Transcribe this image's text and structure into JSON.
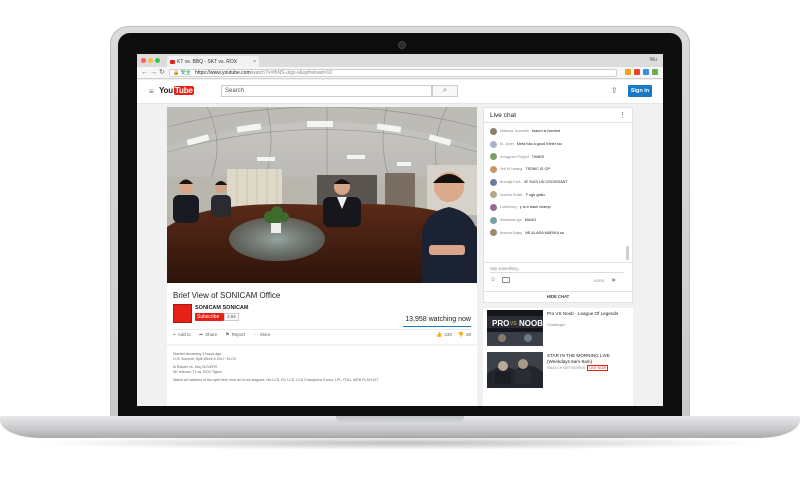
{
  "browser": {
    "tab_title": "KT vs. BBQ - SKT vs. ROX",
    "tab_close": "×",
    "user": "Wu",
    "back_glyph": "←",
    "forward_glyph": "→",
    "reload_glyph": "↻",
    "lock_glyph": "🔒",
    "secure_label": "安全",
    "url_host": "https://www.youtube.com",
    "url_rest": "/watch?v=fhNS-uIgx-s&spfreload=10",
    "menu_glyph": "⋮"
  },
  "header": {
    "menu_glyph": "≡",
    "logo_you": "You",
    "logo_tube": "Tube",
    "search_placeholder": "Search",
    "search_glyph": "⌕",
    "upload_glyph": "⇪",
    "signin_label": "Sign in"
  },
  "video": {
    "title": "Brief View of SONICAM Office",
    "channel": "SONICAM SONICAM",
    "subscribe_label": "Subscribe",
    "subscriber_count": "2,94",
    "watching": "13,958 watching now",
    "actions": [
      {
        "icon": "+",
        "label": "Add to"
      },
      {
        "icon": "➦",
        "label": "Share"
      },
      {
        "icon": "⚑",
        "label": "Report"
      },
      {
        "icon": "⋯",
        "label": "More"
      }
    ],
    "likes": "439",
    "dislikes": "28"
  },
  "description": {
    "lines": [
      "Started streaming 3 hours ago",
      "LCK Summer Split Week 8 2017: KLCK",
      "",
      "kt Rolster vs. bbq OLIVERS",
      "SK telecom T1 vs. ROX Tigers",
      "",
      "Watch all matches of the split here from all of our leagues: NA LCS, EU LCS, LCK Champions Korea, LPL, FULL WEB PLAYLIST"
    ]
  },
  "chat": {
    "title": "Live chat",
    "menu_glyph": "⋮",
    "messages": [
      {
        "author": "Mateusz Grzesiek",
        "text": "braum is banned",
        "color": "#8e7f6a"
      },
      {
        "author": "M. Janet",
        "text": "Meta has a good Kfeier too",
        "color": "#a8b4c4"
      },
      {
        "author": "Zsingyuen Project",
        "text": "TIIMKS",
        "color": "#7b9e6b"
      },
      {
        "author": "Jeff W Hwang",
        "text": "TSDMC IS OP",
        "color": "#c59a6a"
      },
      {
        "author": "Brendja Fers",
        "text": "JE SUIS UN CROISSANT",
        "color": "#6a7fa0"
      },
      {
        "author": "Andrew Butler",
        "text": "F ugh gatiu",
        "color": "#b5a58a"
      },
      {
        "author": "LobMoney",
        "text": "y is a trash champ",
        "color": "#9a6a8e"
      },
      {
        "author": "dimartedo gia",
        "text": "MAHO",
        "color": "#7aa0a8"
      },
      {
        "author": "Andrew Bajay",
        "text": "NE ALARA MARIKA so",
        "color": "#a0886a"
      }
    ],
    "input_placeholder": "Say something...",
    "emoji_glyph": "☺",
    "char_count": "0/200",
    "send_glyph": "➤",
    "hide_label": "HIDE CHAT"
  },
  "related": [
    {
      "title": "Pro VS Noob - League Of Legends",
      "channel": "Challenger",
      "meta": "",
      "live": ""
    },
    {
      "title": "STAR IN THE MORNING LIVE (Weekdays 6am-9am)",
      "channel": "SNATCH NETWORKS",
      "meta": "",
      "live": "LIVE NOW"
    }
  ],
  "colors": {
    "brand_red": "#e62117",
    "brand_blue": "#167ac6"
  }
}
